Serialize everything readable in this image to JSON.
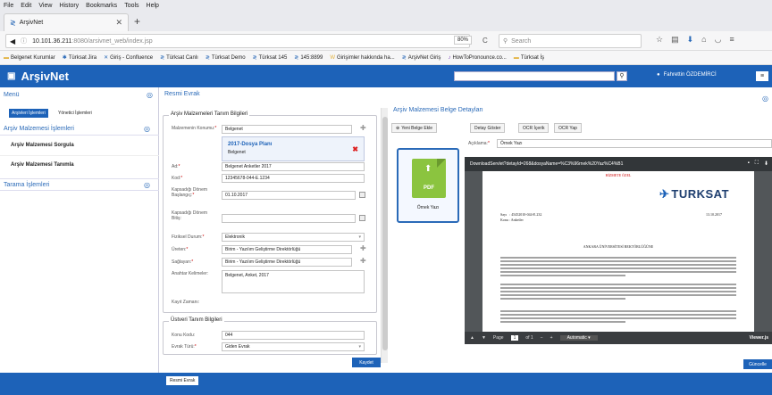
{
  "browser": {
    "menu": [
      "File",
      "Edit",
      "View",
      "History",
      "Bookmarks",
      "Tools",
      "Help"
    ],
    "tab_title": "ArşivNet",
    "url_host": "10.101.36.211",
    "url_rest": ":8080/arsivnet_web/index.jsp",
    "zoom": "80%",
    "search_placeholder": "Search",
    "bookmarks": [
      "Belgenet Kurumlar",
      "Türksat Jira",
      "Giriş - Confluence",
      "Türksat Canlı",
      "Türksat Demo",
      "Türksat 145",
      "145:8899",
      "Girişimler hakkında ha...",
      "ArşivNet Giriş",
      "HowToPronounce.co...",
      "Türksat İş"
    ]
  },
  "app": {
    "title": "ArşivNet",
    "user": "Fahrettin ÖZDEMİRCİ"
  },
  "sidebar": {
    "menu_label": "Menü",
    "tab_active": "Arşivleri İşlemleri",
    "tab_other": "Yönetici İşlemleri",
    "section1": "Arşiv Malzemesi İşlemleri",
    "item1": "Arşiv Malzemesi Sorgula",
    "item2": "Arşiv Malzemesi Tanımla",
    "section2": "Tarama İşlemleri"
  },
  "form": {
    "tab": "Resmi Evrak",
    "fieldset1": "Arşiv Malzemeleri Tanım Bilgileri",
    "malzemenin_konumu_label": "Malzemenin Konumu:",
    "konum_value": "Belgenet",
    "dosya_plani": "2017-Dosya Planı",
    "dosya_sub": "Belgenet",
    "ad_label": "Ad:",
    "ad_value": "Belgenet Anketler 2017",
    "kod_label": "Kod:",
    "kod_value": "12345678-044-E.1234",
    "kapsadigi_baslangic_label": "Kapsadığı Dönem Başlangıç:",
    "baslangic_value": "01.10.2017",
    "kapsadigi_bitis_label": "Kapsadığı Dönem Bitiş:",
    "fiziksel_durum_label": "Fiziksel Durum:",
    "fiziksel_durum_value": "Elektronik",
    "ureten_label": "Üreten:",
    "ureten_value": "Birim - Yazılım Geliştirme Direktörlüğü",
    "saglayan_label": "Sağlayan:",
    "saglayan_value": "Birim - Yazılım Geliştirme Direktörlüğü",
    "anahtar_label": "Anahtar Kelimeler:",
    "anahtar_value": "Belgenet, Anket, 2017",
    "kayit_zamani_label": "Kayıt Zamanı:",
    "fieldset2": "Üstveri Tanım Bilgileri",
    "konu_kodu_label": "Konu Kodu:",
    "konu_kodu_value": "044",
    "evrak_turu_label": "Evrak Türü:",
    "evrak_turu_value": "Giden Evrak",
    "save_button": "Kaydet",
    "footer_tab": "Resmi Evrak"
  },
  "right": {
    "title": "Arşiv Malzemesi Belge Detayları",
    "btn_new": "Yeni Belge Ekle",
    "btn_detail": "Detay Göster",
    "btn_ocr_icerik": "OCR İçerik",
    "btn_ocr_yap": "OCR Yap",
    "file_name": "Örnek Yazı",
    "pdf_label": "PDF",
    "description_label": "Açıklama:",
    "description_value": "Örnek Yazı",
    "viewer_title": "DownloadServlet?detayId=268&dosyaName=%C3%96rnek%20Yaz%C4%B1",
    "classification": "HİZMETE ÖZEL",
    "turksat": "TURKSAT",
    "sayi_label": "Sayı",
    "sayi_value": "45452010-044-E.232",
    "date_value": "13.10.2017",
    "konu_label": "Konu",
    "konu_value": "Anketler",
    "recipient": "ANKARA ÜNİVERSİTESİ REKTÖRLÜĞÜNE",
    "page_label": "Page",
    "page_num": "1",
    "page_of": "of 1",
    "zoom_mode": "Automatic",
    "viewer_label": "Viewer.js",
    "update_button": "Güncelle"
  }
}
